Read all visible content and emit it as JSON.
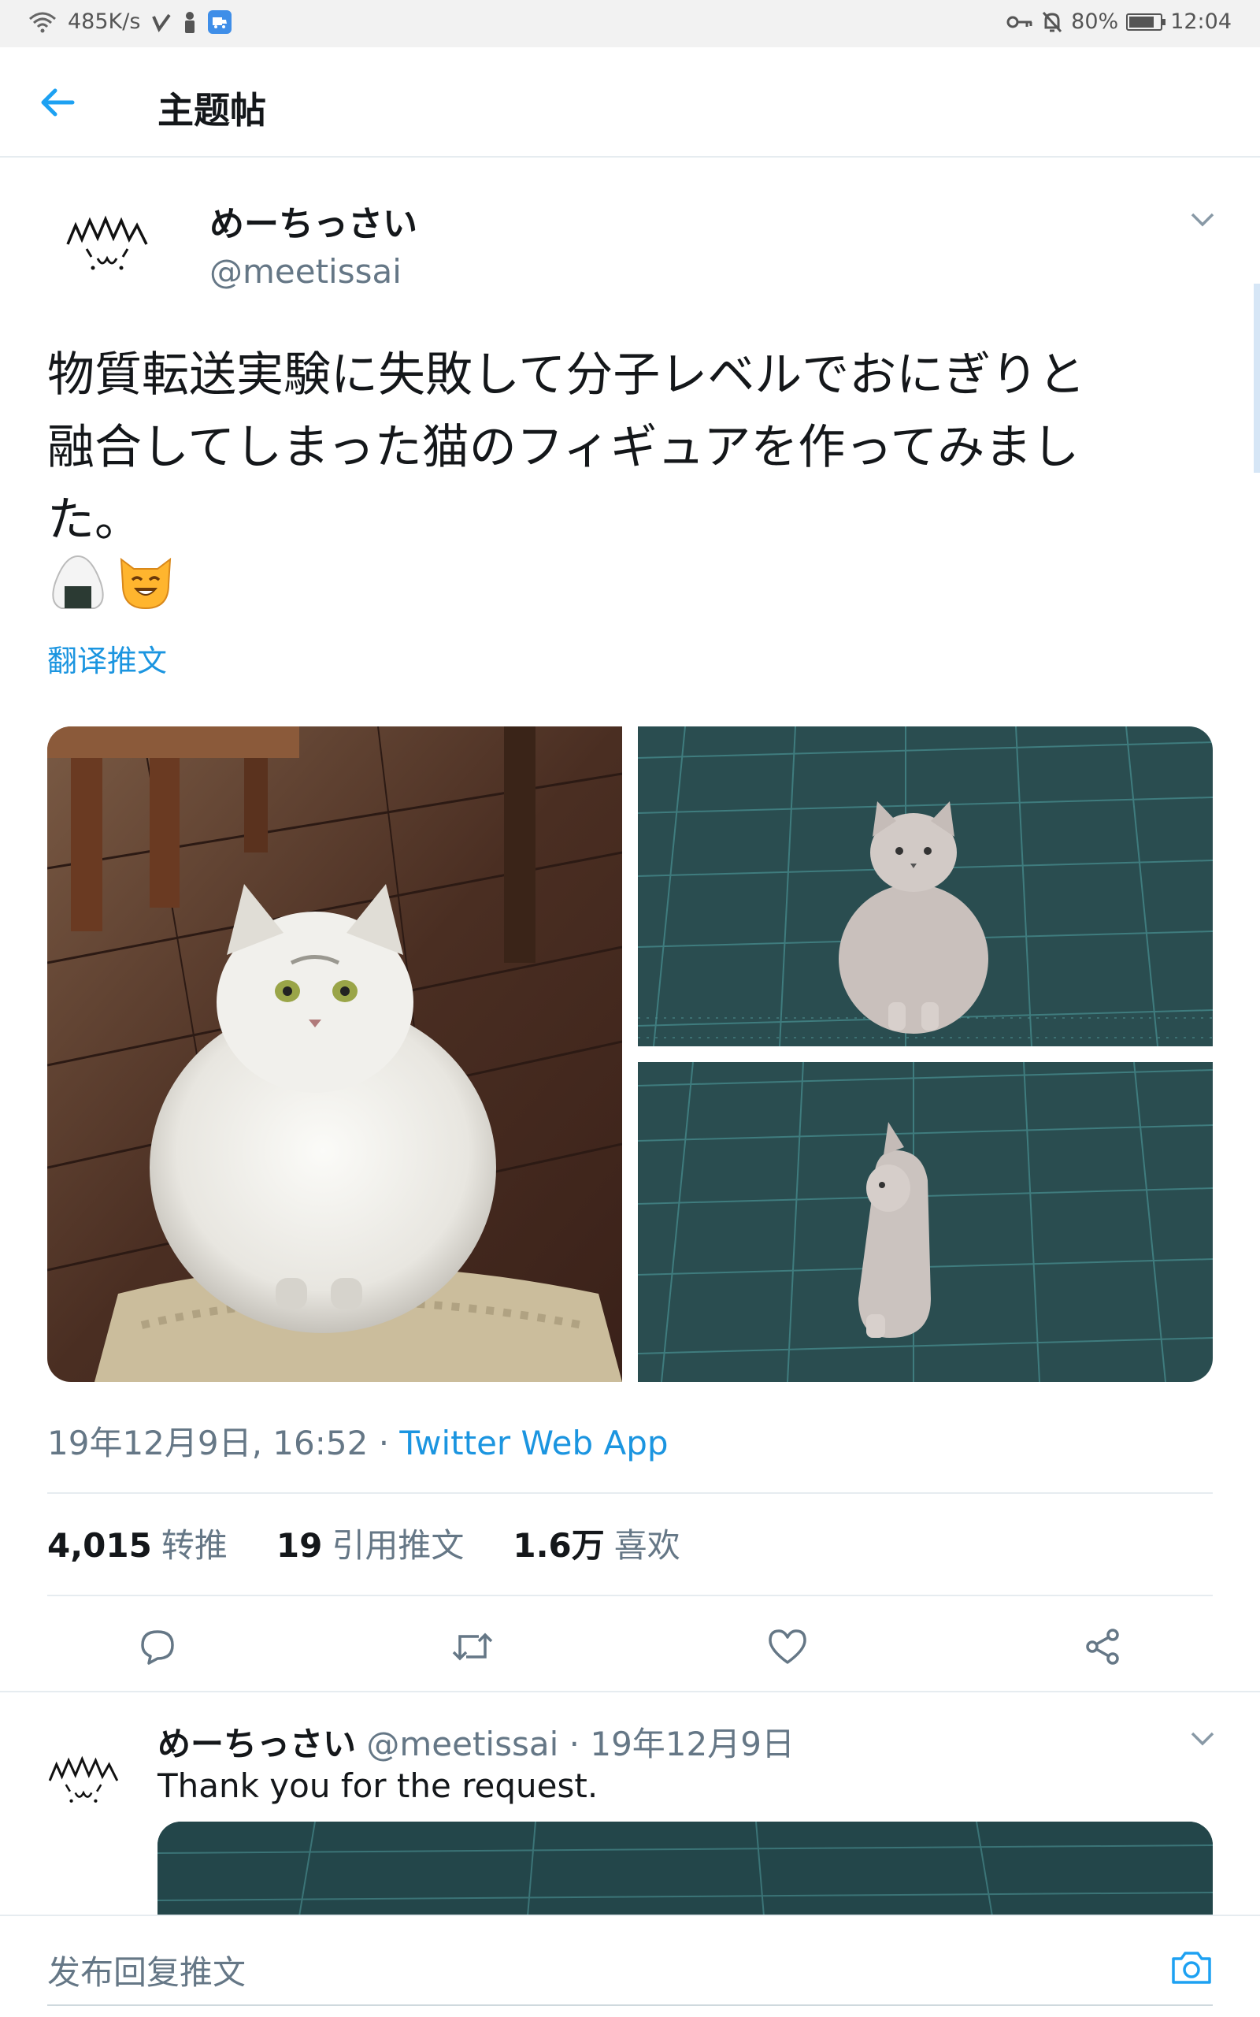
{
  "status_bar": {
    "net_speed": "485K/s",
    "battery": "80%",
    "battery_level": 0.8,
    "time": "12:04"
  },
  "app_bar": {
    "title": "主题帖",
    "back_icon": "arrow-left-icon"
  },
  "tweet": {
    "author_name": "めーちっさい",
    "author_handle": "@meetissai",
    "text": "物質転送実験に失敗して分子レベルでおにぎりと\n融合してしまった猫のフィギュアを作ってみまし\nた。",
    "emojis": [
      "onigiri",
      "smiling-cat"
    ],
    "translate_label": "翻译推文",
    "timestamp": "19年12月9日, 16:52",
    "meta_separator": " · ",
    "source": "Twitter Web App",
    "stats": [
      {
        "value": "4,015",
        "label": "转推"
      },
      {
        "value": "19",
        "label": "引用推文"
      },
      {
        "value": "1.6万",
        "label": "喜欢"
      }
    ],
    "actions": [
      "reply-icon",
      "retweet-icon",
      "like-icon",
      "share-icon"
    ]
  },
  "reply": {
    "author_name": "めーちっさい",
    "author_handle": "@meetissai",
    "date": "· 19年12月9日",
    "text": "Thank you for the request."
  },
  "composer": {
    "placeholder": "发布回复推文",
    "camera_icon": "camera-icon"
  },
  "colors": {
    "accent": "#1b95e0",
    "secondary_text": "#657786",
    "divider": "#e6ecf0",
    "cutting_mat": "#2a4d50"
  }
}
